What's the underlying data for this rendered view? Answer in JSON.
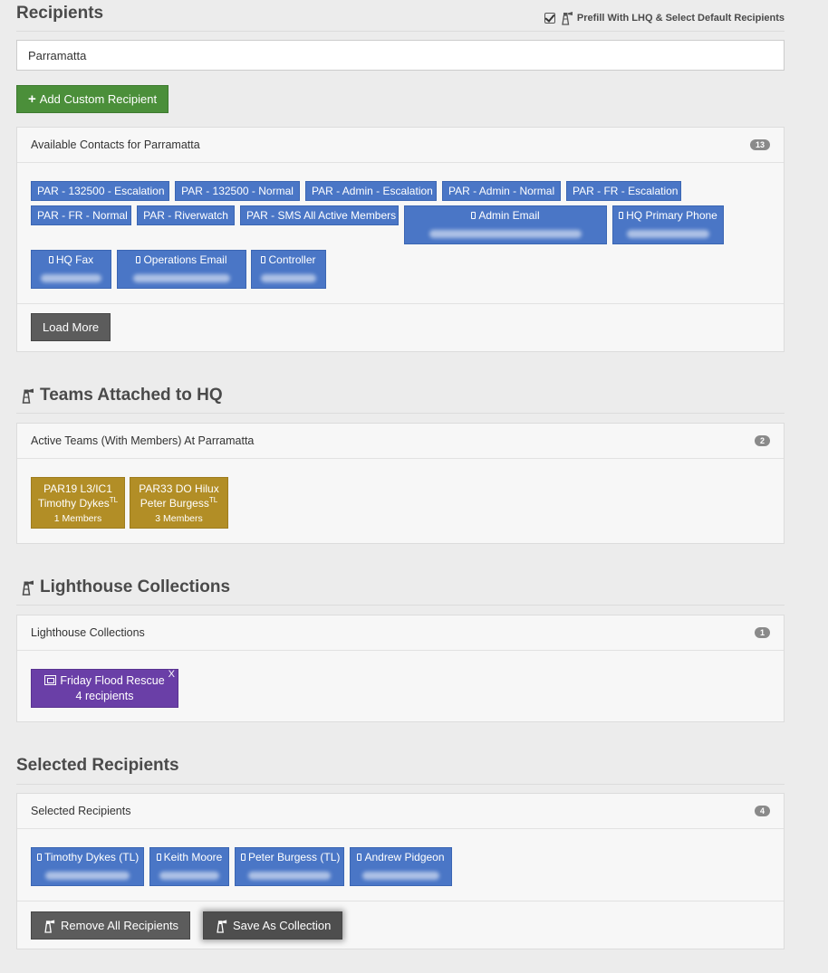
{
  "recipients_header": {
    "title": "Recipients",
    "prefill_label": "Prefill With LHQ & Select Default Recipients",
    "prefill_checked": true
  },
  "search": {
    "value": "Parramatta"
  },
  "add_custom_label": "Add Custom Recipient",
  "contacts_panel": {
    "title": "Available Contacts for Parramatta",
    "count": "13",
    "tags": [
      "PAR - 132500 - Escalation",
      "PAR - 132500 - Normal",
      "PAR - Admin - Escalation",
      "PAR - Admin - Normal",
      "PAR - FR - Escalation",
      "PAR - FR - Normal",
      "PAR - Riverwatch",
      "PAR - SMS All Active Members",
      "Admin Email",
      "HQ Primary Phone",
      "HQ Fax",
      "Operations Email",
      "Controller"
    ],
    "load_more_label": "Load More"
  },
  "teams_section": {
    "title": "Teams Attached to HQ",
    "panel_title": "Active Teams (With Members) At Parramatta",
    "count": "2",
    "teams": [
      {
        "name": "PAR19 L3/IC1",
        "leader": "Timothy Dykes",
        "leader_sup": "TL",
        "members": "1 Members"
      },
      {
        "name": "PAR33 DO Hilux",
        "leader": "Peter Burgess",
        "leader_sup": "TL",
        "members": "3 Members"
      }
    ]
  },
  "collections_section": {
    "title": "Lighthouse Collections",
    "panel_title": "Lighthouse Collections",
    "count": "1",
    "collections": [
      {
        "name": "Friday Flood Rescue",
        "recipients": "4 recipients",
        "remove": "X"
      }
    ]
  },
  "selected_section": {
    "title": "Selected Recipients",
    "panel_title": "Selected Recipients",
    "count": "4",
    "recipients": [
      "Timothy Dykes (TL)",
      "Keith Moore",
      "Peter Burgess (TL)",
      "Andrew Pidgeon"
    ],
    "remove_all_label": "Remove All Recipients",
    "save_collection_label": "Save As Collection"
  },
  "colors": {
    "contact_blue": "#4a76c6",
    "team_gold": "#b28e26",
    "collection_purple": "#6a3fa7",
    "add_green": "#4b8f3a",
    "dark_button": "#5c5c5c"
  }
}
